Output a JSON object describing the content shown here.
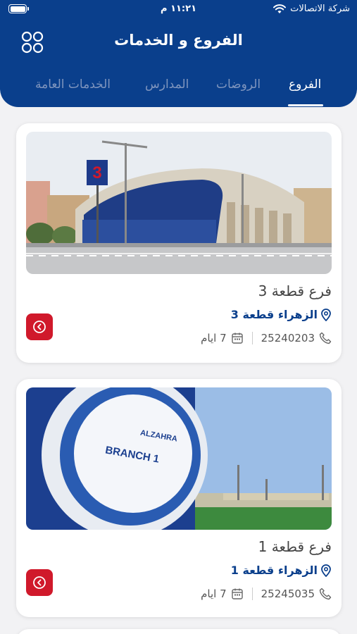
{
  "status": {
    "carrier": "شركة الاتصالات",
    "time": "١١:٢١ م"
  },
  "header": {
    "title": "الفروع و الخدمات"
  },
  "tabs": [
    {
      "label": "الفروع",
      "active": true
    },
    {
      "label": "الروضات",
      "active": false
    },
    {
      "label": "المدارس",
      "active": false
    },
    {
      "label": "الخدمات العامة",
      "active": false
    }
  ],
  "branches": [
    {
      "name": "فرع قطعة 3",
      "location": "الزهراء قطعة 3",
      "phone": "25240203",
      "days": "7 ايام",
      "photo_sign": "3"
    },
    {
      "name": "فرع قطعة 1",
      "location": "الزهراء قطعة 1",
      "phone": "25245035",
      "days": "7 ايام",
      "photo_sign": "BRANCH 1"
    }
  ],
  "colors": {
    "primary": "#0a3f8c",
    "accent": "#d0192b",
    "background": "#f2f2f4"
  },
  "icons": {
    "menu": "grid-circles-icon",
    "nav": "arrow-circle-left-icon",
    "location": "map-pin-icon",
    "phone": "phone-icon",
    "days": "calendar-icon"
  }
}
